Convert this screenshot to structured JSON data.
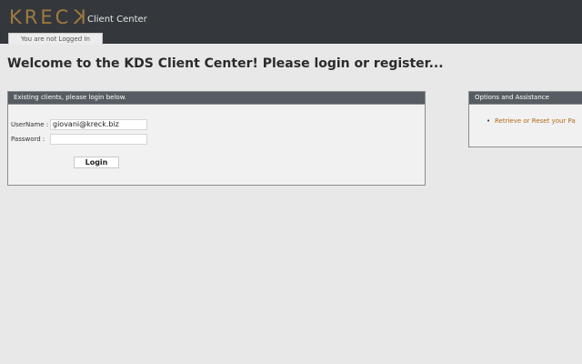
{
  "header": {
    "logo_text": "KREC",
    "logo_last": "K",
    "app_name": "Client Center",
    "login_status": "You are not Logged In"
  },
  "main": {
    "welcome": "Welcome to the KDS Client Center! Please login or register..."
  },
  "login_panel": {
    "title": "Existing clients, please login below.",
    "username_label": "UserName :",
    "username_value": "giovani@kreck.biz",
    "password_label": "Password :",
    "password_value": "",
    "login_button": "Login"
  },
  "assist_panel": {
    "title": "Options and Assistance",
    "links": [
      "Retrieve or Reset your Pa"
    ]
  },
  "colors": {
    "header_bg": "#34383c",
    "panel_header_bg": "#565c62",
    "link": "#b36a1a",
    "logo": "#a07a40"
  }
}
